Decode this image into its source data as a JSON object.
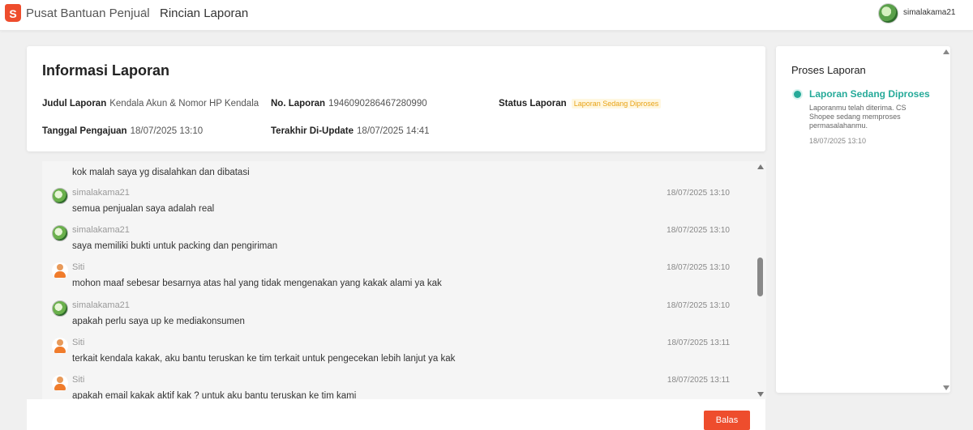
{
  "header": {
    "logo_letter": "S",
    "brand": "Pusat Bantuan Penjual",
    "separator": "›",
    "breadcrumb_current": "Rincian Laporan",
    "username": "simalakama21"
  },
  "info": {
    "title": "Informasi Laporan",
    "judul_label": "Judul Laporan",
    "judul_value": "Kendala Akun & Nomor HP Kendala",
    "no_label": "No. Laporan",
    "no_value": "1946090286467280990",
    "status_label": "Status Laporan",
    "status_value": "Laporan Sedang Diproses",
    "tanggal_label": "Tanggal Pengajuan",
    "tanggal_value": "18/07/2025 13:10",
    "update_label": "Terakhir Di-Update",
    "update_value": "18/07/2025 14:41"
  },
  "chat": {
    "partial_text": "kok malah saya yg disalahkan dan dibatasi",
    "messages": [
      {
        "sender": "simalakama21",
        "time": "18/07/2025 13:10",
        "text": "semua penjualan saya adalah real",
        "type": "user"
      },
      {
        "sender": "simalakama21",
        "time": "18/07/2025 13:10",
        "text": "saya memiliki bukti untuk packing dan pengiriman",
        "type": "user"
      },
      {
        "sender": "Siti",
        "time": "18/07/2025 13:10",
        "text": "mohon maaf sebesar besarnya atas hal yang tidak mengenakan yang kakak alami ya kak",
        "type": "agent"
      },
      {
        "sender": "simalakama21",
        "time": "18/07/2025 13:10",
        "text": "apakah perlu saya up ke mediakonsumen",
        "type": "user"
      },
      {
        "sender": "Siti",
        "time": "18/07/2025 13:11",
        "text": "terkait kendala kakak, aku bantu teruskan ke tim terkait untuk pengecekan lebih lanjut ya kak",
        "type": "agent"
      },
      {
        "sender": "Siti",
        "time": "18/07/2025 13:11",
        "text": "apakah email kakak aktif kak ? untuk aku bantu teruskan ke tim kami",
        "type": "agent"
      }
    ]
  },
  "reply_button": "Balas",
  "process": {
    "title": "Proses Laporan",
    "step_title": "Laporan Sedang Diproses",
    "step_desc": "Laporanmu telah diterima. CS Shopee sedang memproses permasalahanmu.",
    "step_time": "18/07/2025 13:10"
  },
  "colors": {
    "brand": "#ee4d2d",
    "accent": "#26aa99",
    "status_badge": "#e8a317"
  }
}
